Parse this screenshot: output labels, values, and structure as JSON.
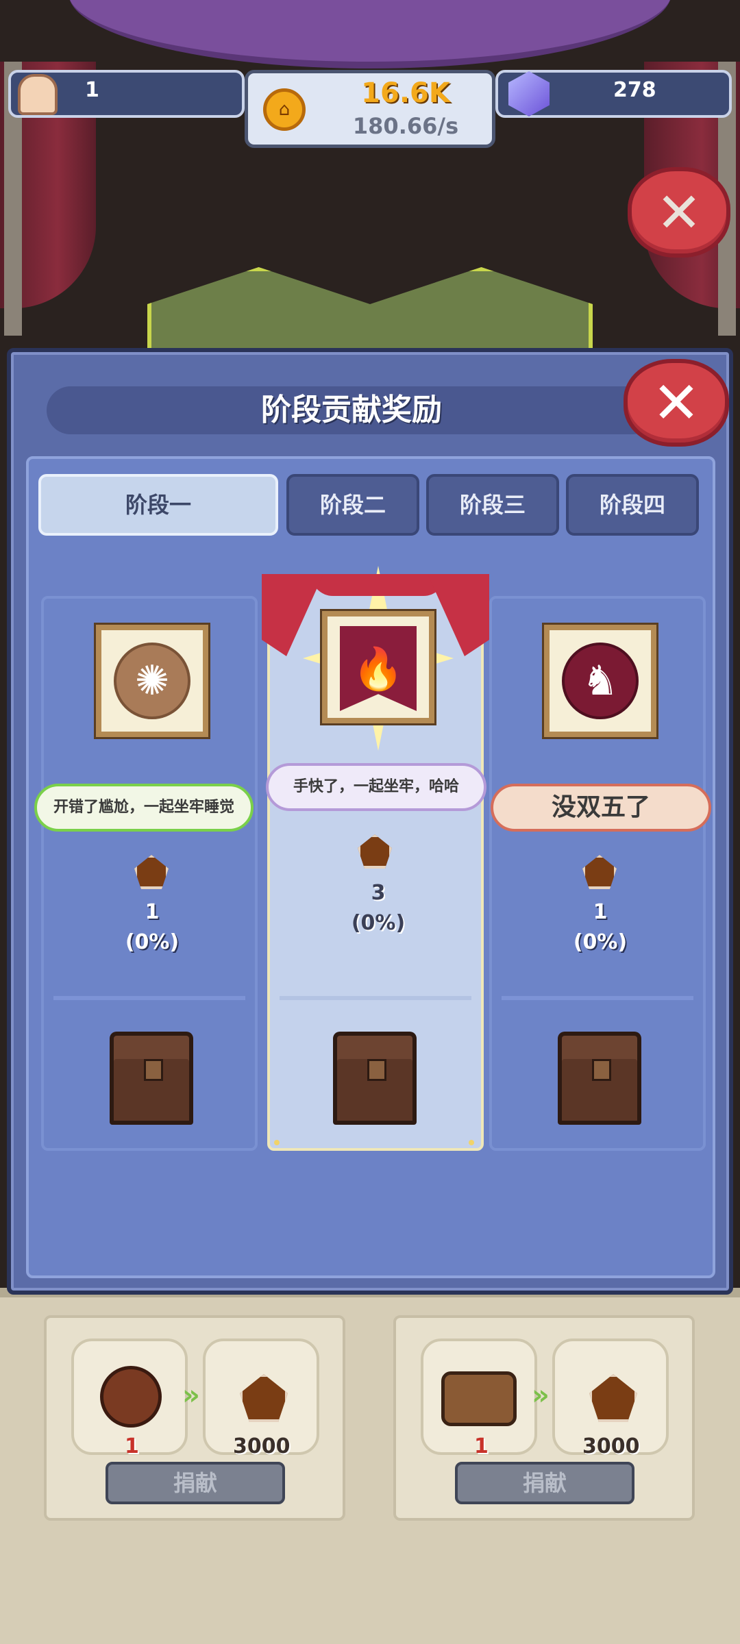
{
  "hud": {
    "population": "1",
    "gold_amount": "16.6K",
    "gold_rate": "180.66/s",
    "gems": "278"
  },
  "modal": {
    "title": "阶段贡献奖励",
    "tabs": [
      "阶段一",
      "阶段二",
      "阶段三",
      "阶段四"
    ],
    "active_tab": 0,
    "rewards": [
      {
        "caption": "开错了尴尬，一起坐牢睡觉",
        "count": "1",
        "percent": "(0%)",
        "emblem": "phoenix-emblem"
      },
      {
        "caption": "手快了，一起坐牢，哈哈",
        "count": "3",
        "percent": "(0%)",
        "emblem": "fire-banner"
      },
      {
        "caption": "没双五了",
        "count": "1",
        "percent": "(0%)",
        "emblem": "dragon-emblem"
      }
    ]
  },
  "donate": {
    "button_label": "捐献",
    "cards": [
      {
        "input_icon": "meat-icon",
        "input_count": "1",
        "output_count": "3000"
      },
      {
        "input_icon": "wood-logs-icon",
        "input_count": "1",
        "output_count": "3000"
      }
    ]
  },
  "colors": {
    "modal_bg": "#5b6ca8",
    "active_tab": "#c6d5ec",
    "close_red": "#d24148",
    "gold": "#f3a91b"
  }
}
